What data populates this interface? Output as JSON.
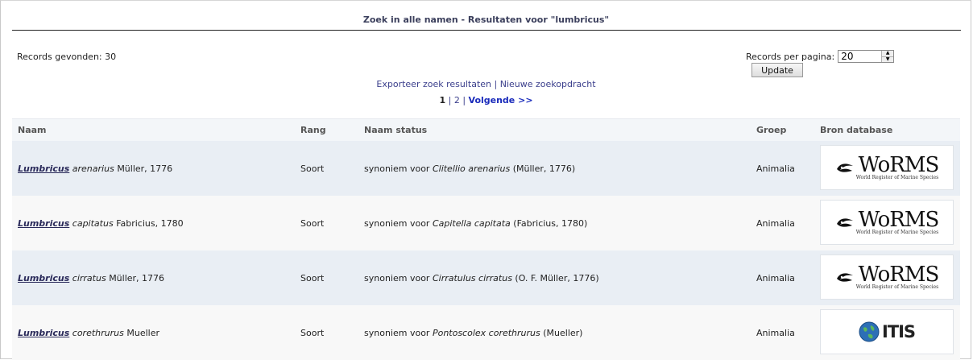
{
  "header": {
    "title": "Zoek in alle namen - Resultaten voor \"lumbricus\""
  },
  "summary": {
    "records_found": "Records gevonden: 30",
    "per_page_label": "Records per pagina:",
    "per_page_value": "20",
    "update_label": "Update"
  },
  "links": {
    "export": "Exporteer zoek resultaten",
    "separator": "|",
    "new_search": "Nieuwe zoekopdracht"
  },
  "pager": {
    "current": "1",
    "sep1": "|",
    "page2": "2",
    "sep2": "|",
    "next": "Volgende >>"
  },
  "table": {
    "headers": {
      "name": "Naam",
      "rank": "Rang",
      "status": "Naam status",
      "group": "Groep",
      "source": "Bron database"
    },
    "rows": [
      {
        "genus": "Lumbricus",
        "species": "arenarius",
        "author": "Müller, 1776",
        "rank": "Soort",
        "status_prefix": "synoniem voor",
        "status_taxon": "Clitellio arenarius",
        "status_author": "(Müller, 1776)",
        "group": "Animalia",
        "source": "worms"
      },
      {
        "genus": "Lumbricus",
        "species": "capitatus",
        "author": "Fabricius, 1780",
        "rank": "Soort",
        "status_prefix": "synoniem voor",
        "status_taxon": "Capitella capitata",
        "status_author": "(Fabricius, 1780)",
        "group": "Animalia",
        "source": "worms"
      },
      {
        "genus": "Lumbricus",
        "species": "cirratus",
        "author": "Müller, 1776",
        "rank": "Soort",
        "status_prefix": "synoniem voor",
        "status_taxon": "Cirratulus cirratus",
        "status_author": "(O. F. Müller, 1776)",
        "group": "Animalia",
        "source": "worms"
      },
      {
        "genus": "Lumbricus",
        "species": "corethrurus",
        "author": "Mueller",
        "rank": "Soort",
        "status_prefix": "synoniem voor",
        "status_taxon": "Pontoscolex corethrurus",
        "status_author": "(Mueller)",
        "group": "Animalia",
        "source": "itis"
      }
    ]
  },
  "logos": {
    "worms": {
      "big": "WoRMS",
      "small": "World Register of Marine Species"
    },
    "itis": {
      "text": "ITIS"
    }
  },
  "colors": {
    "link": "#3b3f8c",
    "next": "#1a2bbb",
    "row_alt": "#e9eef4",
    "header_bg": "#f3f6f9"
  }
}
